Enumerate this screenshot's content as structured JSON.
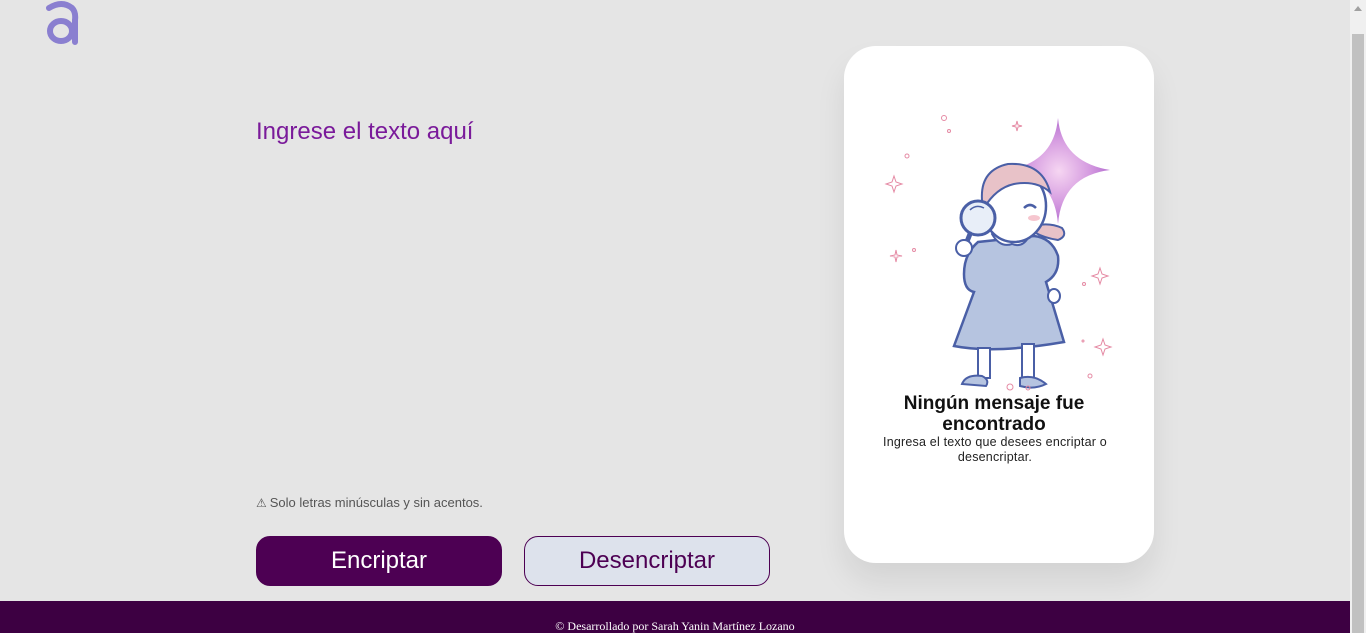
{
  "logo": {
    "letter": "a",
    "icon": "alura-logo-icon",
    "color": "#8a7fd0"
  },
  "input": {
    "placeholder": "Ingrese el texto aquí",
    "value": ""
  },
  "hint": {
    "icon": "warning-icon",
    "symbol": "⚠",
    "text": "Solo letras minúsculas y sin acentos."
  },
  "buttons": {
    "encrypt_label": "Encriptar",
    "decrypt_label": "Desencriptar"
  },
  "output": {
    "illustration": "girl-with-magnifying-glass-illustration",
    "title": "Ningún mensaje fue encontrado",
    "subtitle": "Ingresa el texto que desees encriptar o desencriptar."
  },
  "footer": {
    "text": "© Desarrollado por Sarah Yanin Martínez Lozano"
  },
  "colors": {
    "background": "#e5e5e5",
    "primary": "#4d0053",
    "accent_text": "#7a1a9a",
    "footer_bg": "#3d0042",
    "card_bg": "#ffffff"
  }
}
